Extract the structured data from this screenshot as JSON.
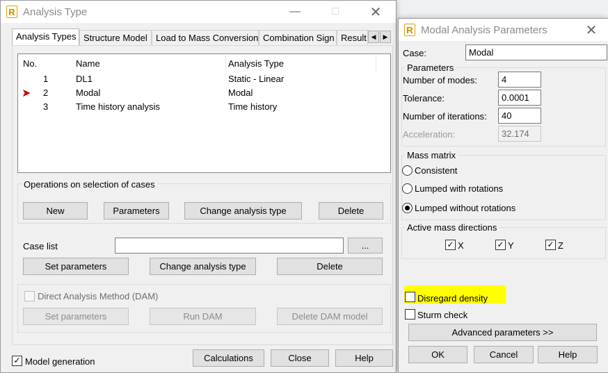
{
  "analysis_window": {
    "title": "Analysis Type",
    "tabs": [
      "Analysis Types",
      "Structure Model",
      "Load to Mass Conversion",
      "Combination Sign",
      "Result"
    ],
    "table": {
      "headers": [
        "No.",
        "Name",
        "Analysis Type"
      ],
      "rows": [
        {
          "no": "1",
          "name": "DL1",
          "type": "Static - Linear"
        },
        {
          "no": "2",
          "name": "Modal",
          "type": "Modal"
        },
        {
          "no": "3",
          "name": "Time history analysis",
          "type": "Time history"
        }
      ]
    },
    "ops_group": "Operations on selection of cases",
    "ops_buttons": {
      "new": "New",
      "parameters": "Parameters",
      "change": "Change analysis type",
      "delete": "Delete"
    },
    "case_list_label": "Case list",
    "case_list_value": "",
    "browse_button": "...",
    "case_buttons": {
      "set": "Set parameters",
      "change": "Change analysis type",
      "delete": "Delete"
    },
    "dam": {
      "label": "Direct Analysis Method (DAM)",
      "set": "Set parameters",
      "run": "Run DAM",
      "delete": "Delete DAM model"
    },
    "model_generation": "Model generation",
    "bottom_buttons": {
      "calculations": "Calculations",
      "close": "Close",
      "help": "Help"
    }
  },
  "modal_window": {
    "title": "Modal Analysis Parameters",
    "case_label": "Case:",
    "case_value": "Modal",
    "parameters_group": "Parameters",
    "modes_label": "Number of modes:",
    "modes_value": "4",
    "tolerance_label": "Tolerance:",
    "tolerance_value": "0.0001",
    "iterations_label": "Number of iterations:",
    "iterations_value": "40",
    "acceleration_label": "Acceleration:",
    "acceleration_value": "32.174",
    "mass_matrix_group": "Mass matrix",
    "consistent": "Consistent",
    "lumped_rot": "Lumped with rotations",
    "lumped_no_rot": "Lumped without rotations",
    "directions_group": "Active mass directions",
    "dir_x": "X",
    "dir_y": "Y",
    "dir_z": "Z",
    "disregard_density": "Disregard density",
    "sturm_check": "Sturm check",
    "advanced": "Advanced parameters >>",
    "ok": "OK",
    "cancel": "Cancel",
    "help": "Help"
  },
  "colors": {
    "highlight": "#ffff00",
    "arrow": "#d00000"
  },
  "icons": {
    "app_logo": "robot-logo-icon",
    "close": "close-icon",
    "minimize": "minimize-icon",
    "maximize": "maximize-icon",
    "arrow": "arrow-right-icon"
  }
}
